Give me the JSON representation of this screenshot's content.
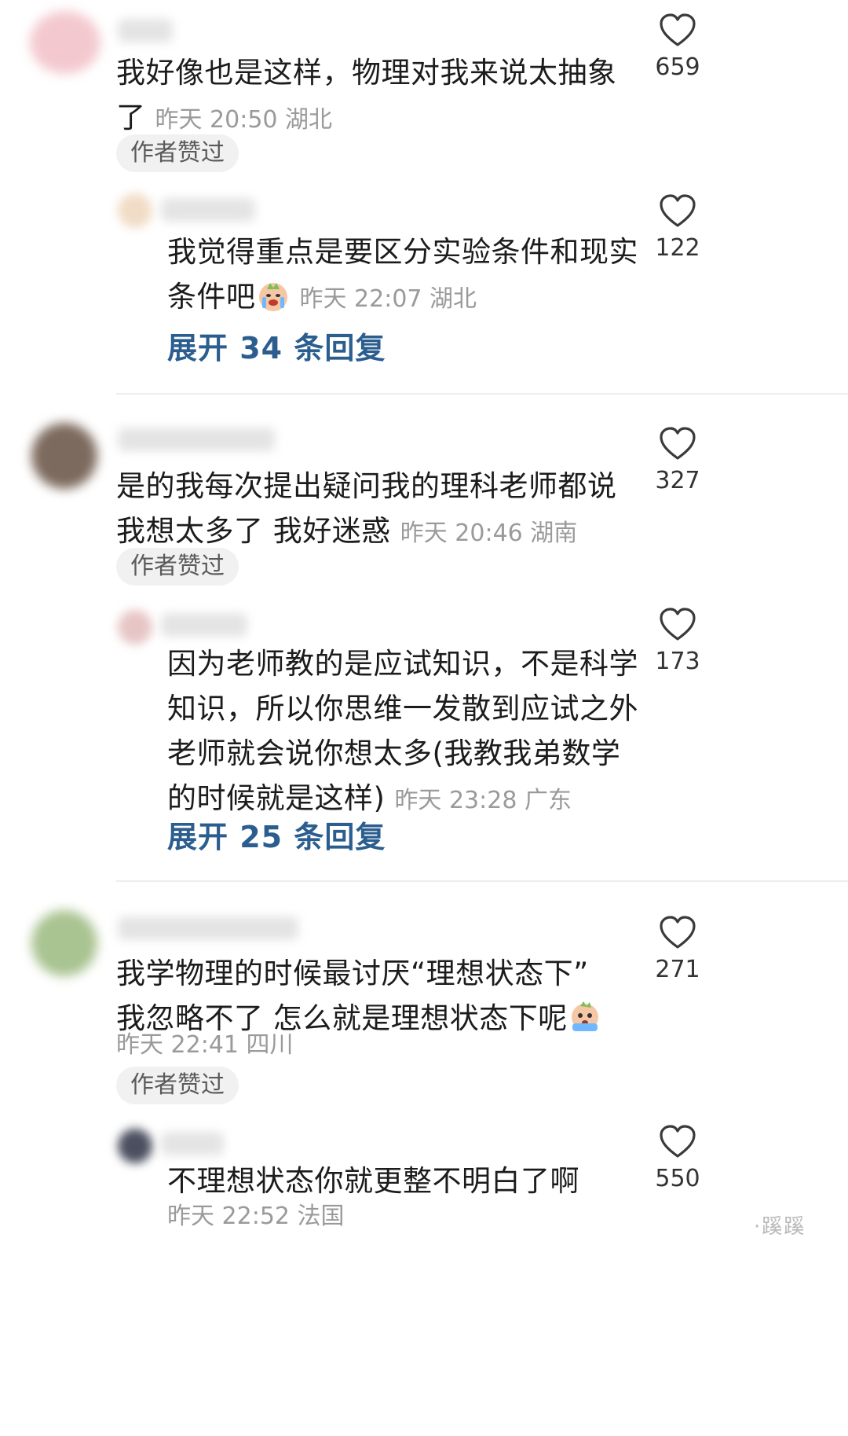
{
  "comments": [
    {
      "text_lines": [
        "我好像也是这样，物理对我来说太抽象",
        "了"
      ],
      "meta": "昨天 20:50 湖北",
      "badge": "作者赞过",
      "likes": "659",
      "reply": {
        "text_lines": [
          "我觉得重点是要区分实验条件和现实",
          "条件吧"
        ],
        "emoji": "crying-face-emoji",
        "meta": "昨天 22:07 湖北",
        "likes": "122"
      },
      "expand": "展开 34 条回复"
    },
    {
      "text_lines": [
        "是的我每次提出疑问我的理科老师都说",
        "我想太多了 我好迷惑"
      ],
      "meta": "昨天 20:46 湖南",
      "badge": "作者赞过",
      "likes": "327",
      "reply": {
        "text_lines": [
          "因为老师教的是应试知识，不是科学",
          "知识，所以你思维一发散到应试之外",
          "老师就会说你想太多(我教我弟数学",
          "的时候就是这样)"
        ],
        "meta": "昨天 23:28 广东",
        "likes": "173"
      },
      "expand": "展开 25 条回复"
    },
    {
      "text_lines": [
        "我学物理的时候最讨厌“理想状态下”",
        "我忽略不了 怎么就是理想状态下呢"
      ],
      "emoji": "scared-face-emoji",
      "meta": "昨天 22:41 四川",
      "badge": "作者赞过",
      "likes": "271",
      "reply": {
        "text_lines": [
          "不理想状态你就更整不明白了啊"
        ],
        "meta": "昨天 22:52 法国",
        "likes": "550"
      }
    }
  ],
  "watermark": "·蹊蹊"
}
